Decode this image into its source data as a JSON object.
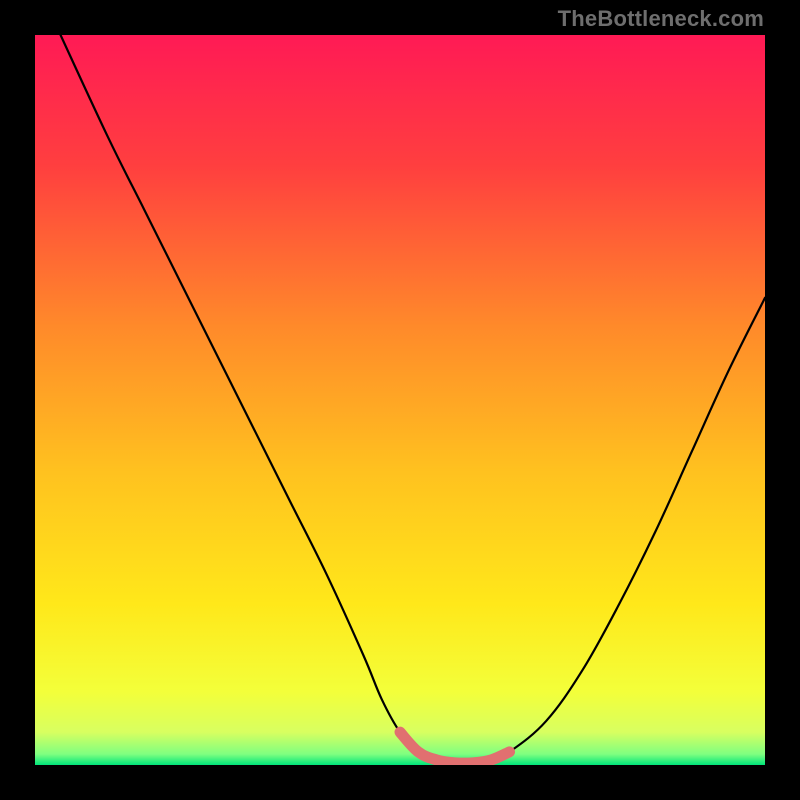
{
  "watermark": "TheBottleneck.com",
  "colors": {
    "frame": "#000000",
    "curve": "#000000",
    "highlight": "#e17070",
    "gradient_stops": [
      {
        "offset": 0.0,
        "color": "#ff1a55"
      },
      {
        "offset": 0.18,
        "color": "#ff3f3f"
      },
      {
        "offset": 0.4,
        "color": "#ff8a2a"
      },
      {
        "offset": 0.6,
        "color": "#ffc21f"
      },
      {
        "offset": 0.78,
        "color": "#ffe81a"
      },
      {
        "offset": 0.9,
        "color": "#f3ff3a"
      },
      {
        "offset": 0.955,
        "color": "#d8ff60"
      },
      {
        "offset": 0.985,
        "color": "#80ff80"
      },
      {
        "offset": 1.0,
        "color": "#00e57a"
      }
    ]
  },
  "chart_data": {
    "type": "line",
    "title": "",
    "xlabel": "",
    "ylabel": "",
    "xlim": [
      0,
      1
    ],
    "ylim": [
      0,
      1
    ],
    "series": [
      {
        "name": "curve",
        "x": [
          0.035,
          0.1,
          0.15,
          0.2,
          0.25,
          0.3,
          0.35,
          0.4,
          0.45,
          0.475,
          0.5,
          0.525,
          0.55,
          0.575,
          0.6,
          0.625,
          0.65,
          0.7,
          0.75,
          0.8,
          0.85,
          0.9,
          0.95,
          1.0
        ],
        "values": [
          1.0,
          0.86,
          0.76,
          0.66,
          0.56,
          0.46,
          0.36,
          0.26,
          0.15,
          0.09,
          0.045,
          0.018,
          0.007,
          0.003,
          0.003,
          0.007,
          0.018,
          0.06,
          0.13,
          0.22,
          0.32,
          0.43,
          0.54,
          0.64
        ]
      },
      {
        "name": "highlight",
        "x": [
          0.5,
          0.525,
          0.55,
          0.575,
          0.6,
          0.625,
          0.65
        ],
        "values": [
          0.045,
          0.018,
          0.007,
          0.003,
          0.003,
          0.007,
          0.018
        ]
      }
    ],
    "annotations": []
  }
}
